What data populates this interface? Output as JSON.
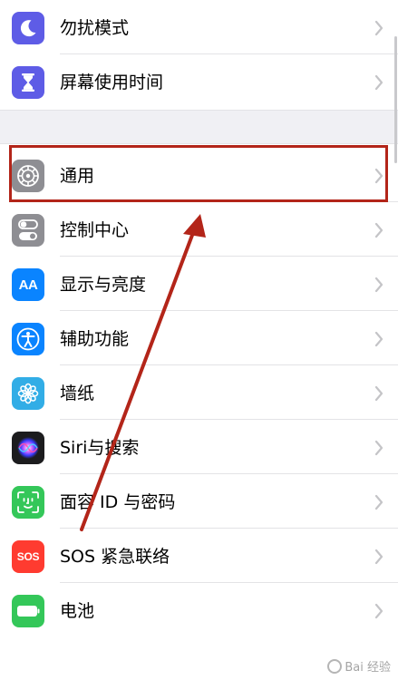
{
  "settings": {
    "group_top": [
      {
        "label": "勿扰模式",
        "icon": "moon-icon",
        "color": "#5e5ce6"
      },
      {
        "label": "屏幕使用时间",
        "icon": "hourglass-icon",
        "color": "#5e5ce6"
      }
    ],
    "group_main": [
      {
        "label": "通用",
        "icon": "gear-icon",
        "color": "#8e8e93"
      },
      {
        "label": "控制中心",
        "icon": "toggles-icon",
        "color": "#8e8e93"
      },
      {
        "label": "显示与亮度",
        "icon": "text-size-icon",
        "color": "#0a84ff"
      },
      {
        "label": "辅助功能",
        "icon": "accessibility-icon",
        "color": "#0a84ff"
      },
      {
        "label": "墙纸",
        "icon": "flower-icon",
        "color": "#32ade6"
      },
      {
        "label": "Siri与搜索",
        "icon": "siri-icon",
        "color": "#1c1c1e"
      },
      {
        "label": "面容 ID 与密码",
        "icon": "face-id-icon",
        "color": "#34c759"
      },
      {
        "label": "SOS 紧急联络",
        "icon": "sos-icon",
        "color": "#ff3b30"
      },
      {
        "label": "电池",
        "icon": "battery-icon",
        "color": "#34c759"
      }
    ],
    "icon_text": {
      "display": "AA",
      "sos": "SOS"
    }
  },
  "annotation": {
    "highlight_color": "#b32519",
    "highlighted_item": "通用"
  },
  "watermark": {
    "text": "Bai 经验"
  }
}
